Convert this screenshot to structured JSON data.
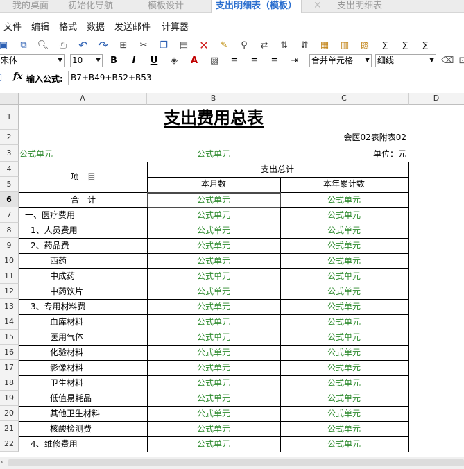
{
  "tabs": [
    {
      "label": "我的桌面",
      "active": false
    },
    {
      "label": "初始化导航",
      "active": false
    },
    {
      "label": "模板设计",
      "active": false
    },
    {
      "label": "支出明细表（模板）",
      "active": true
    },
    {
      "label": "支出明细表",
      "active": false
    }
  ],
  "tab_close_glyph": "✕",
  "menu": [
    "文件",
    "编辑",
    "格式",
    "数据",
    "发送邮件",
    "计算器"
  ],
  "toolbar_icons": [
    "save-icon",
    "save-as-icon",
    "print-preview-icon",
    "print-icon",
    "undo-icon",
    "redo-icon",
    "select-all-icon",
    "cut-icon",
    "copy-icon",
    "paste-icon",
    "delete-icon",
    "format-painter-icon",
    "find-icon",
    "replace-icon",
    "sort-asc-icon",
    "sort-desc-icon",
    "insert-row-icon",
    "paste-special-icon",
    "paste-values-icon",
    "paste-format-icon",
    "sum-icon",
    "sum-row-icon",
    "sum-col-icon"
  ],
  "format_bar": {
    "font": "宋体",
    "size": "10",
    "bold": "B",
    "italic": "I",
    "underline": "U",
    "merge": "合并单元格",
    "border": "细线"
  },
  "formula_bar": {
    "fx": "fx",
    "label": "输入公式:",
    "value": "B7+B49+B52+B53"
  },
  "columns": [
    "A",
    "B",
    "C",
    "D"
  ],
  "rows": [
    "1",
    "2",
    "3",
    "4",
    "5",
    "6",
    "7",
    "8",
    "9",
    "10",
    "11",
    "12",
    "13",
    "14",
    "15",
    "16",
    "17",
    "18",
    "19",
    "20",
    "21",
    "22"
  ],
  "sheet": {
    "title": "支出费用总表",
    "subtitle_right": "会医02表附表02",
    "formula_cell": "公式单元",
    "unit": "单位：元",
    "header_item": "项　目",
    "header_total": "支出总计",
    "header_month": "本月数",
    "header_year": "本年累计数",
    "items": [
      "合　计",
      "一、医疗费用",
      "1、人员费用",
      "2、药品费",
      "西药",
      "中成药",
      "中药饮片",
      "3、专用材料费",
      "血库材料",
      "医用气体",
      "化验材料",
      "影像材料",
      "卫生材料",
      "低值易耗品",
      "其他卫生材料",
      "核酸检测费",
      "4、维修费用"
    ]
  }
}
